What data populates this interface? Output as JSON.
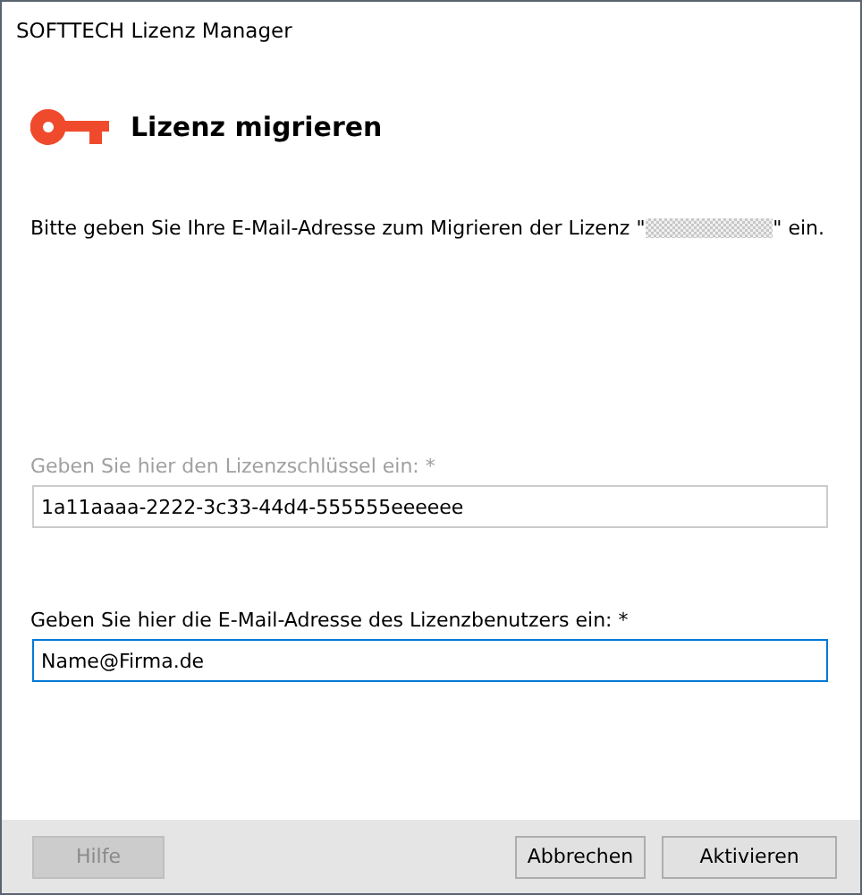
{
  "window": {
    "title": "SOFTTECH Lizenz Manager"
  },
  "header": {
    "title": "Lizenz migrieren"
  },
  "intro": {
    "before": "Bitte geben Sie Ihre E-Mail-Adresse zum Migrieren der Lizenz \"",
    "after": "\" ein.",
    "redacted": true
  },
  "fields": [
    {
      "label": "Geben Sie hier den Lizenzschlüssel ein: *",
      "value": "1a11aaaa-2222-3c33-44d4-555555eeeeee",
      "disabled": true,
      "focused": false
    },
    {
      "label": "Geben Sie hier die E-Mail-Adresse des Lizenzbenutzers ein: *",
      "value": "Name@Firma.de",
      "disabled": false,
      "focused": true
    }
  ],
  "buttons": [
    {
      "label": "Hilfe",
      "disabled": true
    },
    {
      "label": "Abbrechen",
      "disabled": false
    },
    {
      "label": "Aktivieren",
      "disabled": false
    }
  ]
}
